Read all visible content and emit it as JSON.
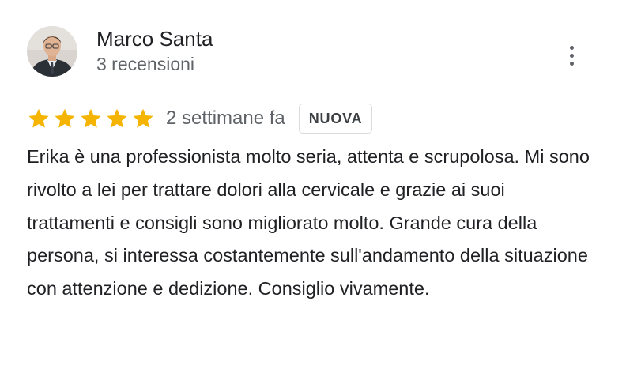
{
  "review": {
    "author": {
      "name": "Marco Santa",
      "reviews_count": "3 recensioni"
    },
    "rating": {
      "stars": 5,
      "max_stars": 5,
      "color": "#f4b400"
    },
    "time": "2 settimane fa",
    "badge": "NUOVA",
    "text": "Erika è una professionista molto seria, attenta e scrupolosa. Mi sono rivolto a lei per trattare dolori alla cervicale e grazie ai suoi trattamenti e consigli sono migliorato molto. Grande cura della persona, si interessa costantemente sull'andamento della situazione con attenzione e dedizione. Consiglio vivamente.",
    "menu_icon": "more-vert-icon"
  }
}
